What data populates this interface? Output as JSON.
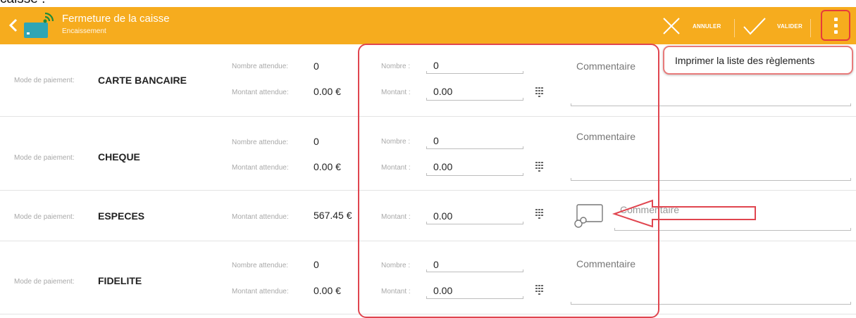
{
  "caption_cropped": "caisse :",
  "header": {
    "title": "Fermeture de la caisse",
    "subtitle": "Encaissement",
    "cancel_label": "ANNULER",
    "validate_label": "VALIDER",
    "accent_color": "#f6ac1e"
  },
  "overflow_menu": {
    "items": [
      "Imprimer la liste des règlements"
    ]
  },
  "labels": {
    "payment_mode": "Mode de paiement:",
    "expected_count": "Nombre attendue:",
    "expected_amount": "Montant attendue:",
    "count": "Nombre :",
    "amount": "Montant :",
    "comment": "Commentaire"
  },
  "rows": [
    {
      "mode": "CARTE BANCAIRE",
      "expected_count": "0",
      "expected_amount": "0.00 €",
      "count": "0",
      "amount": "0.00"
    },
    {
      "mode": "CHEQUE",
      "expected_count": "0",
      "expected_amount": "0.00 €",
      "count": "0",
      "amount": "0.00"
    },
    {
      "mode": "ESPECES",
      "expected_amount": "567.45 €",
      "amount": "0.00"
    },
    {
      "mode": "FIDELITE",
      "expected_count": "0",
      "expected_amount": "0.00 €",
      "count": "0",
      "amount": "0.00"
    }
  ]
}
